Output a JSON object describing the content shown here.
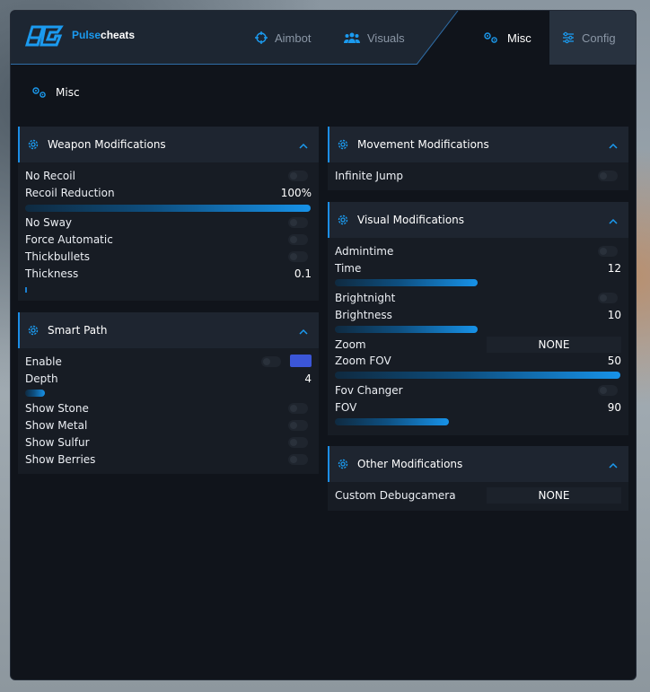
{
  "brand": {
    "part1": "Pulse",
    "part2": "cheats"
  },
  "nav": [
    {
      "label": "Aimbot",
      "icon": "crosshair-icon",
      "active": false
    },
    {
      "label": "Visuals",
      "icon": "users-icon",
      "active": false
    },
    {
      "label": "Misc",
      "icon": "gears-icon",
      "active": true
    },
    {
      "label": "Config",
      "icon": "sliders-icon",
      "active": false
    }
  ],
  "page": {
    "title": "Misc"
  },
  "colors": {
    "accent": "#1c8ee6",
    "swatch": "#3b56d8",
    "window": "#10141b",
    "panel": "#171c24"
  },
  "weapon": {
    "title": "Weapon Modifications",
    "no_recoil": "No Recoil",
    "recoil_reduction": "Recoil Reduction",
    "recoil_reduction_value": "100%",
    "recoil_reduction_fraction": 1.0,
    "no_sway": "No Sway",
    "force_automatic": "Force Automatic",
    "thickbullets": "Thickbullets",
    "thickness": "Thickness",
    "thickness_value": "0.1"
  },
  "smart_path": {
    "title": "Smart Path",
    "enable": "Enable",
    "depth": "Depth",
    "depth_value": "4",
    "show_stone": "Show Stone",
    "show_metal": "Show Metal",
    "show_sulfur": "Show Sulfur",
    "show_berries": "Show Berries"
  },
  "movement": {
    "title": "Movement Modifications",
    "infinite_jump": "Infinite Jump"
  },
  "visual": {
    "title": "Visual Modifications",
    "admintime": "Admintime",
    "time": "Time",
    "time_value": "12",
    "brightnight": "Brightnight",
    "brightness": "Brightness",
    "brightness_value": "10",
    "zoom": "Zoom",
    "zoom_select": "NONE",
    "zoom_fov": "Zoom FOV",
    "zoom_fov_value": "50",
    "fov_changer": "Fov Changer",
    "fov": "FOV",
    "fov_value": "90"
  },
  "other": {
    "title": "Other Modifications",
    "custom_debugcamera": "Custom Debugcamera",
    "debugcamera_select": "NONE"
  }
}
